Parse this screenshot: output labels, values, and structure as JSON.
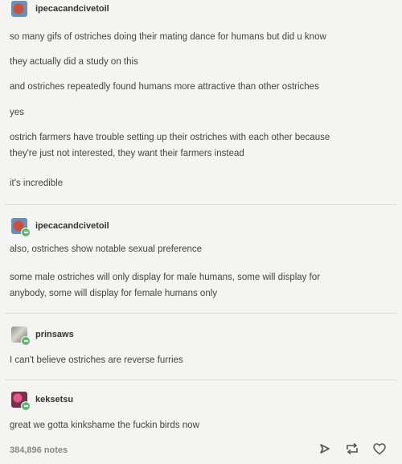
{
  "posts": [
    {
      "username": "ipecacandcivetoil",
      "lines": [
        "so many gifs of ostriches doing their mating dance for humans but did u know",
        "they actually did a study on this",
        "and ostriches repeatedly found humans more attractive than other ostriches",
        "yes",
        "ostrich farmers have trouble setting up their ostriches with each other because",
        "they're just not interested, they want their farmers instead",
        "it's incredible"
      ],
      "avatar_icon": "avatar-icon"
    },
    {
      "username": "ipecacandcivetoil",
      "lines": [
        "also, ostriches show notable sexual preference",
        "some male ostriches will only display for male humans, some will display for",
        "anybody, some will display for female humans only"
      ],
      "avatar_icon": "avatar-icon"
    },
    {
      "username": "prinsaws",
      "lines": [
        "I can't believe ostriches are reverse furries"
      ],
      "avatar_icon": "avatar-icon"
    },
    {
      "username": "keksetsu",
      "lines": [
        "great we gotta kinkshame the fuckin birds now"
      ],
      "avatar_icon": "avatar-icon"
    }
  ],
  "footer": {
    "notes": "384,896 notes",
    "icons": [
      "share-icon",
      "reblog-icon",
      "like-icon"
    ]
  },
  "colors": {
    "background": "#f4f4f2",
    "text": "#444444",
    "follow_badge": "#5fb870"
  }
}
